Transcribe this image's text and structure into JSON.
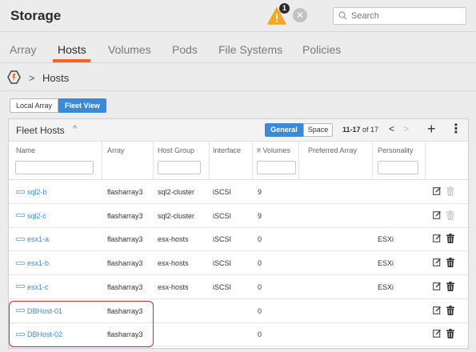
{
  "header": {
    "title": "Storage",
    "alert_count": "1",
    "alert_icon": "warning-triangle-icon",
    "close_glyph": "✕",
    "search_placeholder": "Search"
  },
  "tabs": [
    {
      "label": "Array",
      "active": false
    },
    {
      "label": "Hosts",
      "active": true
    },
    {
      "label": "Volumes",
      "active": false
    },
    {
      "label": "Pods",
      "active": false
    },
    {
      "label": "File Systems",
      "active": false
    },
    {
      "label": "Policies",
      "active": false
    }
  ],
  "breadcrumb": {
    "separator": ">",
    "current": "Hosts"
  },
  "view_toggle": {
    "local_label": "Local Array",
    "fleet_label": "Fleet View",
    "active": "Fleet View"
  },
  "panel": {
    "title": "Fleet Hosts",
    "caret": "^",
    "general_label": "General",
    "space_label": "Space",
    "pager_range": "11-17",
    "pager_of": "of 17",
    "prev_glyph": "<",
    "next_glyph": ">",
    "add_glyph": "+",
    "more_glyph": "⋮"
  },
  "columns": [
    "Name",
    "Array",
    "Host Group",
    "Interface",
    "# Volumes",
    "Preferred Array",
    "Personality"
  ],
  "rows": [
    {
      "name": "sql2-b",
      "array": "flasharray3",
      "host_group": "sql2-cluster",
      "interface": "iSCSI",
      "volumes": "9",
      "preferred_array": "",
      "personality": "",
      "delete_enabled": false
    },
    {
      "name": "sql2-c",
      "array": "flasharray3",
      "host_group": "sql2-cluster",
      "interface": "iSCSI",
      "volumes": "9",
      "preferred_array": "",
      "personality": "",
      "delete_enabled": false
    },
    {
      "name": "esx1-a",
      "array": "flasharray3",
      "host_group": "esx-hosts",
      "interface": "iSCSI",
      "volumes": "0",
      "preferred_array": "",
      "personality": "ESXi",
      "delete_enabled": true
    },
    {
      "name": "esx1-b",
      "array": "flasharray3",
      "host_group": "esx-hosts",
      "interface": "iSCSI",
      "volumes": "0",
      "preferred_array": "",
      "personality": "ESXi",
      "delete_enabled": true
    },
    {
      "name": "esx1-c",
      "array": "flasharray3",
      "host_group": "esx-hosts",
      "interface": "iSCSI",
      "volumes": "0",
      "preferred_array": "",
      "personality": "ESXi",
      "delete_enabled": true
    },
    {
      "name": "DBHost-01",
      "array": "flasharray3",
      "host_group": "",
      "interface": "",
      "volumes": "0",
      "preferred_array": "",
      "personality": "",
      "delete_enabled": true
    },
    {
      "name": "DBHost-02",
      "array": "flasharray3",
      "host_group": "",
      "interface": "",
      "volumes": "0",
      "preferred_array": "",
      "personality": "",
      "delete_enabled": true
    }
  ],
  "colors": {
    "accent": "#3a8ad8",
    "tab_underline": "#f26522",
    "warning": "#f5a623",
    "highlight": "#d42a2a"
  }
}
